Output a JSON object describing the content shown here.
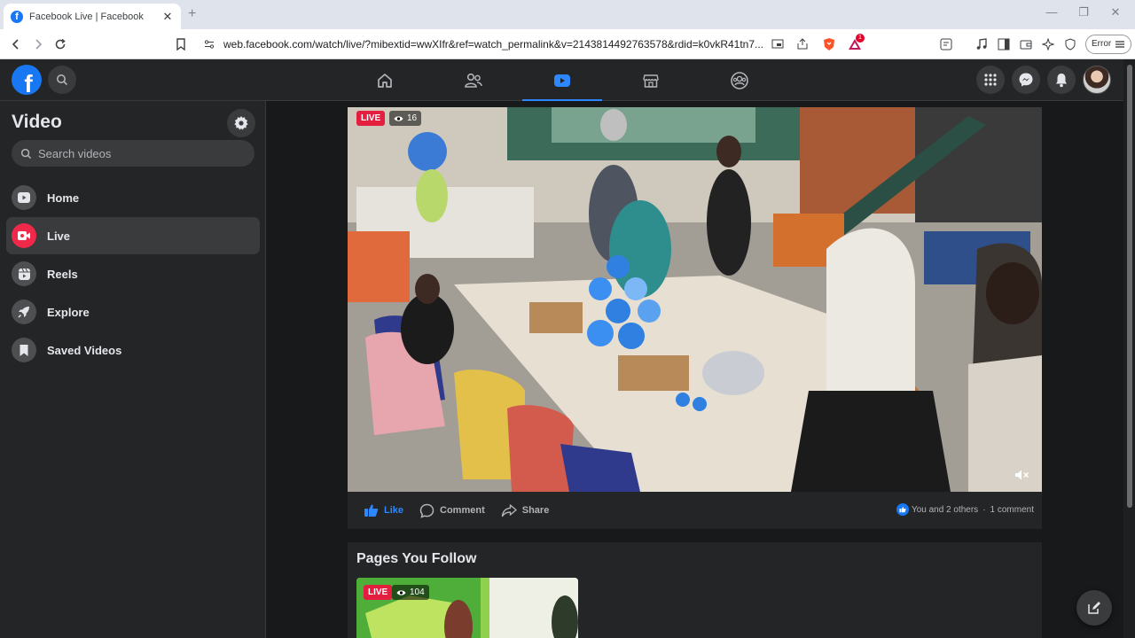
{
  "browser": {
    "tab_title": "Facebook Live | Facebook",
    "url": "web.facebook.com/watch/live/?mibextid=wwXIfr&ref=watch_permalink&v=2143814492763578&rdid=k0vkR41tn7...",
    "error_label": "Error",
    "notification_badge": "1"
  },
  "sidebar": {
    "title": "Video",
    "search_placeholder": "Search videos",
    "items": [
      {
        "label": "Home",
        "icon": "video-home-icon"
      },
      {
        "label": "Live",
        "icon": "live-camera-icon",
        "active": true
      },
      {
        "label": "Reels",
        "icon": "reels-icon"
      },
      {
        "label": "Explore",
        "icon": "rocket-icon"
      },
      {
        "label": "Saved Videos",
        "icon": "bookmark-icon"
      }
    ]
  },
  "video": {
    "live_label": "LIVE",
    "viewer_count": "16",
    "actions": {
      "like": "Like",
      "comment": "Comment",
      "share": "Share"
    },
    "reactions_text": "You and 2 others",
    "separator": "·",
    "comments_text": "1 comment"
  },
  "pages_you_follow": {
    "title": "Pages You Follow",
    "thumb_live_label": "LIVE",
    "thumb_viewer_count": "104"
  },
  "colors": {
    "accent": "#2d88ff",
    "live": "#e41e3f",
    "brand": "#1877f2"
  }
}
